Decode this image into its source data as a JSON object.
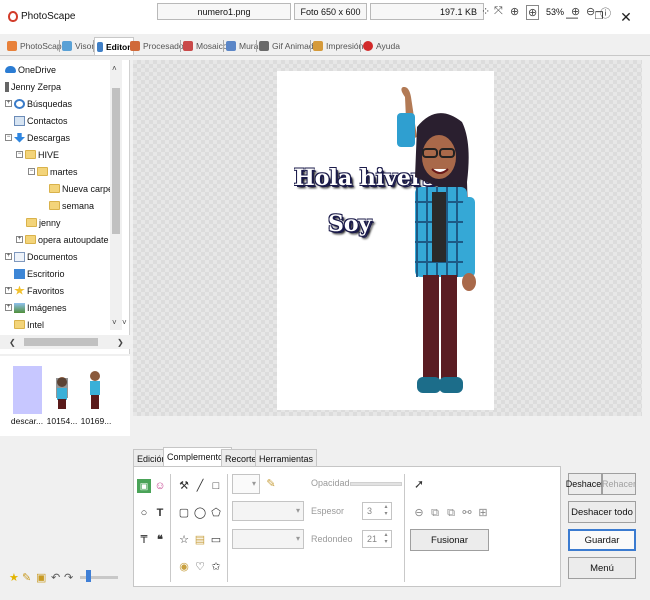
{
  "window": {
    "title": "PhotoScape",
    "minimize": "—",
    "maximize": "❐",
    "close": "✕"
  },
  "tabs": [
    {
      "label": "PhotoScape",
      "color": "#e8813a"
    },
    {
      "label": "Visor",
      "color": "#5aa1d6"
    },
    {
      "label": "Editor",
      "color": "#3f7fc6",
      "active": true
    },
    {
      "label": "Procesador",
      "color": "#d06a3a"
    },
    {
      "label": "Mosaico",
      "color": "#c94a4a"
    },
    {
      "label": "Mural",
      "color": "#5b86c7"
    },
    {
      "label": "Gif Animado",
      "color": "#6a6a6a"
    },
    {
      "label": "Impresión",
      "color": "#d59a3a"
    },
    {
      "label": "Ayuda",
      "color": "#d22a2a"
    }
  ],
  "tree": {
    "items": [
      {
        "label": "OneDrive",
        "icon": "onedrive-icon"
      },
      {
        "label": "Jenny Zerpa",
        "icon": "user-icon"
      },
      {
        "label": "Búsquedas",
        "icon": "search-icon"
      },
      {
        "label": "Contactos",
        "icon": "contacts-icon"
      },
      {
        "label": "Descargas",
        "icon": "download-icon"
      },
      {
        "label": "HIVE",
        "icon": "folder-icon"
      },
      {
        "label": "martes",
        "icon": "folder-icon"
      },
      {
        "label": "Nueva carpeta",
        "icon": "folder-icon"
      },
      {
        "label": "semana",
        "icon": "folder-icon"
      },
      {
        "label": "jenny",
        "icon": "folder-icon"
      },
      {
        "label": "opera autoupdate",
        "icon": "folder-icon"
      },
      {
        "label": "Documentos",
        "icon": "documents-icon"
      },
      {
        "label": "Escritorio",
        "icon": "desktop-icon"
      },
      {
        "label": "Favoritos",
        "icon": "star-icon"
      },
      {
        "label": "Imágenes",
        "icon": "pictures-icon"
      },
      {
        "label": "Intel",
        "icon": "folder-icon"
      }
    ],
    "expand": "+",
    "collapse": "−",
    "scroll_up": "˄",
    "scroll_down": "˅",
    "scroll_left": "❮",
    "scroll_right": "❯"
  },
  "thumbnails": [
    {
      "label": "descar...",
      "color": "#c7c7ff"
    },
    {
      "label": "10154...",
      "color": "#ffffff"
    },
    {
      "label": "10169...",
      "color": "#ffffff"
    }
  ],
  "photo": {
    "line1": "Hola hivers",
    "line2": "Soy"
  },
  "statusbar": {
    "filename": "numero1.png",
    "dimensions": "Foto 650 x 600",
    "filesize": "197.1 KB",
    "zoom": "53%"
  },
  "editor_tabs": [
    "Edición",
    "Complementos",
    "Recorte",
    "Herramientas"
  ],
  "active_editor_tab": "Complementos",
  "tools": {
    "opacity_label": "Opacidad",
    "grosor_label": "Espesor",
    "grosor_value": "3",
    "redondeo_label": "Redondeo",
    "redondeo_value": "21",
    "fusionar": "Fusionar"
  },
  "actions": {
    "deshacer": "Deshacer",
    "rehacer": "Rehacer",
    "deshacer_todo": "Deshacer todo",
    "guardar": "Guardar",
    "menu": "Menú"
  }
}
